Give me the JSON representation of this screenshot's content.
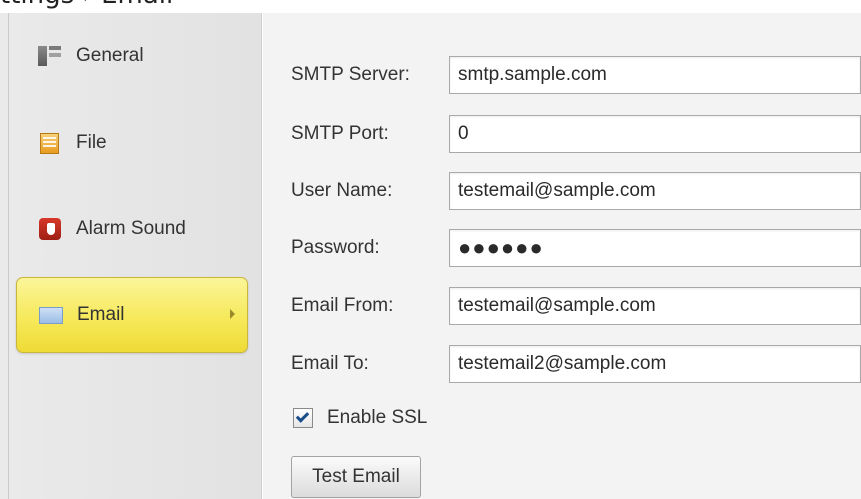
{
  "caption": "ttings › Email",
  "sidebar": {
    "items": [
      {
        "label": "General",
        "icon": "general-settings-icon",
        "active": false
      },
      {
        "label": "File",
        "icon": "file-icon",
        "active": false
      },
      {
        "label": "Alarm Sound",
        "icon": "alarm-sound-icon",
        "active": false
      },
      {
        "label": "Email",
        "icon": "email-envelope-icon",
        "active": true
      }
    ],
    "active_color": "#f6e95a"
  },
  "form": {
    "smtp_server": {
      "label": "SMTP Server:",
      "value": "smtp.sample.com"
    },
    "smtp_port": {
      "label": "SMTP Port:",
      "value": "0"
    },
    "user_name": {
      "label": "User Name:",
      "value": "testemail@sample.com"
    },
    "password": {
      "label": "Password:",
      "value": "●●●●●●"
    },
    "email_from": {
      "label": "Email From:",
      "value": "testemail@sample.com"
    },
    "email_to": {
      "label": "Email To:",
      "value": "testemail2@sample.com"
    },
    "enable_ssl": {
      "label": "Enable SSL",
      "checked": true
    },
    "test_button": {
      "label": "Test Email"
    }
  }
}
